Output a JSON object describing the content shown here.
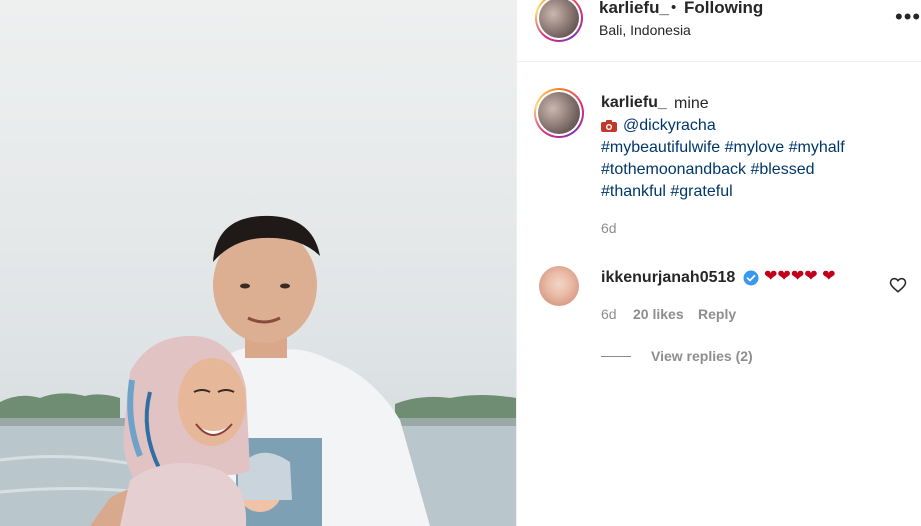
{
  "header": {
    "username": "karliefu_",
    "separator": "•",
    "follow_status": "Following",
    "location": "Bali, Indonesia",
    "more_icon": "more-horizontal-icon"
  },
  "caption": {
    "username": "karliefu_",
    "lines": [
      "mine",
      "@dickyracha",
      "#mybeautifulwife #mylove #myhalf",
      "#tothemoonandback #blessed",
      "#thankful #grateful"
    ],
    "camera_icon": "camera-icon",
    "time": "6d"
  },
  "comment": {
    "username": "ikkenurjanah0518",
    "verified_icon": "verified-badge-icon",
    "text": "❤❤❤❤ ❤",
    "time": "6d",
    "likes": "20 likes",
    "reply_label": "Reply",
    "like_icon": "heart-outline-icon",
    "view_replies": "View replies (2)"
  },
  "colors": {
    "text": "#262626",
    "link": "#00376b",
    "muted": "#8e8e8e",
    "heart": "#c0001b",
    "verified": "#3897f0"
  }
}
